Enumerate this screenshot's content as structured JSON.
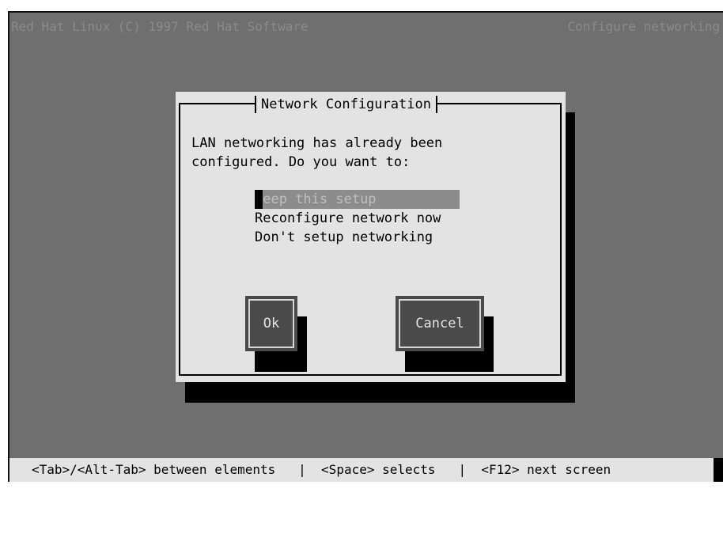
{
  "header": {
    "left_text": "Red Hat Linux (C) 1997 Red Hat Software",
    "right_text": "Configure networking"
  },
  "dialog": {
    "title": "Network Configuration",
    "message": "LAN networking has already been\nconfigured. Do you want to:",
    "options": [
      {
        "cursor": "K",
        "rest": "eep this setup",
        "selected": true
      },
      {
        "label": "Reconfigure network now",
        "selected": false
      },
      {
        "label": "Don't setup networking",
        "selected": false
      }
    ],
    "ok_label": "Ok",
    "cancel_label": "Cancel"
  },
  "statusbar": {
    "text": "<Tab>/<Alt-Tab> between elements   |  <Space> selects   |  <F12> next screen"
  },
  "colors": {
    "screen_background": "#6f6f6f",
    "dialog_background": "#e3e3e3",
    "button_background": "#4a4a4a",
    "selection_background": "#8c8c8c",
    "shadow": "#000000"
  }
}
